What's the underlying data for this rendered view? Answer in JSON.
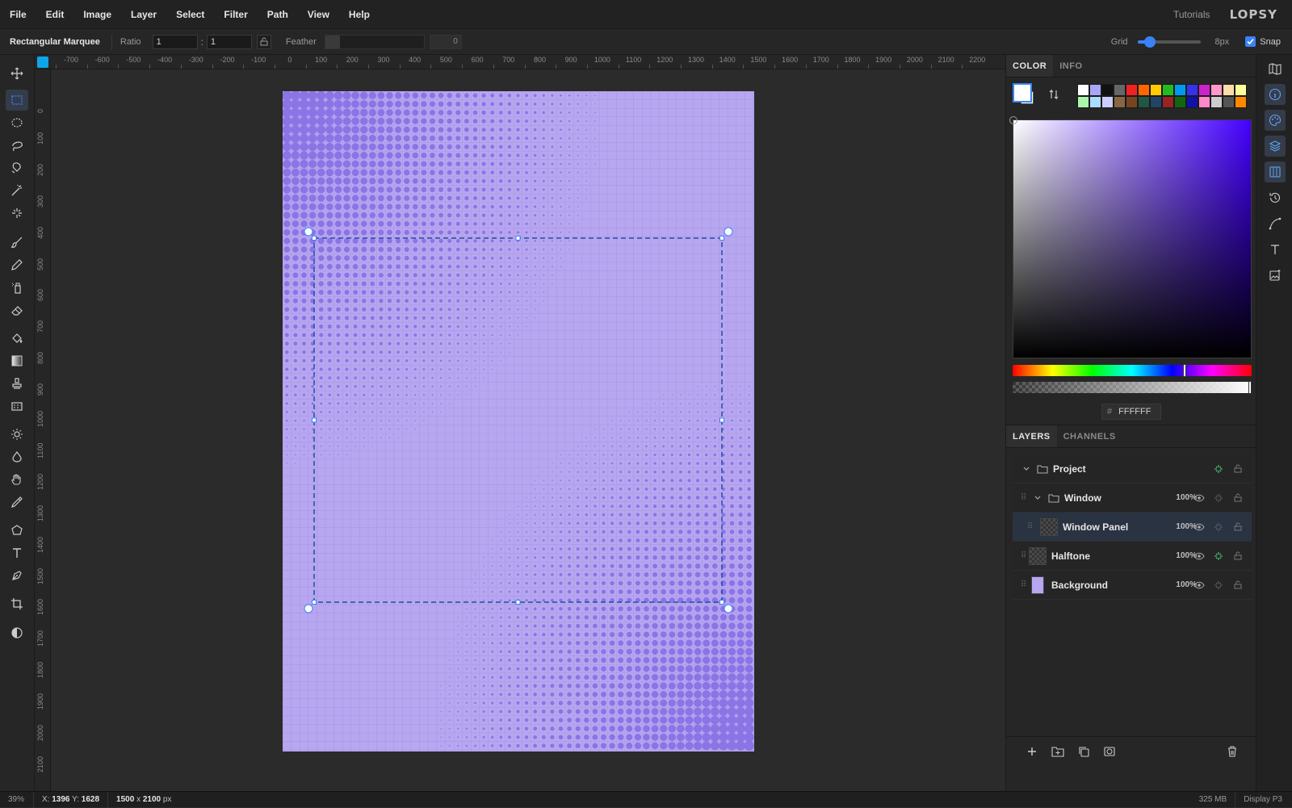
{
  "menu": {
    "items": [
      "File",
      "Edit",
      "Image",
      "Layer",
      "Select",
      "Filter",
      "Path",
      "View",
      "Help"
    ],
    "tutorials": "Tutorials",
    "logo": "LOPSY"
  },
  "options": {
    "tool_name": "Rectangular Marquee",
    "ratio_label": "Ratio",
    "ratio_w": "1",
    "ratio_sep": ":",
    "ratio_h": "1",
    "feather_label": "Feather",
    "feather_value": "0",
    "grid_label": "Grid",
    "grid_size_label": "8px",
    "grid_level": 0.12,
    "snap_label": "Snap",
    "snap_checked": true
  },
  "ruler": {
    "top_labels": [
      "-700",
      "-600",
      "-500",
      "-400",
      "-300",
      "-200",
      "-100",
      "0",
      "100",
      "200",
      "300",
      "400",
      "500",
      "600",
      "700",
      "800",
      "900",
      "1000",
      "1100",
      "1200",
      "1300",
      "1400",
      "1500",
      "1600",
      "1700",
      "1800",
      "1900",
      "2000",
      "2100",
      "2200"
    ],
    "left_labels": [
      "0",
      "100",
      "200",
      "300",
      "400",
      "500",
      "600",
      "700",
      "800",
      "900",
      "1000",
      "1100",
      "1200",
      "1300",
      "1400",
      "1500",
      "1600",
      "1700",
      "1800",
      "1900",
      "2000",
      "2100"
    ]
  },
  "color_panel": {
    "tabs": [
      "COLOR",
      "INFO"
    ],
    "active_tab": "COLOR",
    "foreground": "#ffffff",
    "background": "#ffffff",
    "hex_label": "#",
    "hex_value": "FFFFFF",
    "palette": [
      "#ffffff",
      "#aaa6f5",
      "#111111",
      "#666666",
      "#ee2222",
      "#ff6600",
      "#ffcc00",
      "#22bb22",
      "#0099ee",
      "#3333ee",
      "#cc22cc",
      "#ff99cc",
      "#ffddaa",
      "#ffff99",
      "#aaf5aa",
      "#aaddff",
      "#ccccff",
      "#886644",
      "#774422",
      "#225544",
      "#224466",
      "#992222",
      "#116611",
      "#1111aa",
      "#ff88cc",
      "#cccccc",
      "#555555",
      "#ff8800"
    ]
  },
  "layers_panel": {
    "tabs": [
      "LAYERS",
      "CHANNELS"
    ],
    "active_tab": "LAYERS",
    "layers": [
      {
        "name": "Project",
        "type": "group",
        "opacity": ""
      },
      {
        "name": "Window",
        "type": "group",
        "opacity": "100%"
      },
      {
        "name": "Window Panel",
        "type": "layer",
        "opacity": "100%"
      },
      {
        "name": "Halftone",
        "type": "layer",
        "opacity": "100%"
      },
      {
        "name": "Background",
        "type": "layer",
        "opacity": "100%"
      }
    ]
  },
  "document": {
    "fill": "#b7a6f0",
    "dot_color": "#8a74e6"
  },
  "status": {
    "zoom": "39%",
    "x_label": "X:",
    "x_value": "1396",
    "y_label": "Y:",
    "y_value": "1628",
    "dims_w": "1500",
    "dims_x": "x",
    "dims_h": "2100",
    "dims_unit": "px",
    "memory": "325 MB",
    "profile": "Display P3"
  }
}
